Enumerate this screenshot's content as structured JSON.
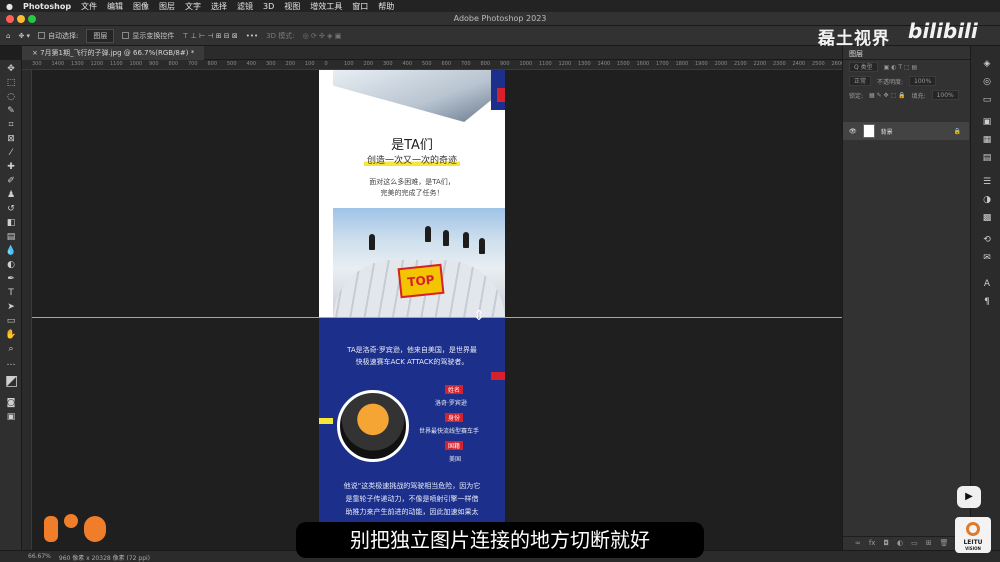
{
  "menubar": {
    "apple_icon": "apple-icon",
    "app_name": "Photoshop",
    "items": [
      "文件",
      "编辑",
      "图像",
      "图层",
      "文字",
      "选择",
      "滤镜",
      "3D",
      "视图",
      "增效工具",
      "窗口",
      "帮助"
    ]
  },
  "window": {
    "title": "Adobe Photoshop 2023"
  },
  "options": {
    "auto_select_label": "自动选择:",
    "auto_select_value": "图层",
    "show_transform_label": "显示变换控件",
    "mode_3d_label": "3D 模式:"
  },
  "document": {
    "tab_label": "7月第1期_飞行的子弹.jpg @ 66.7%(RGB/8#) *"
  },
  "ruler": {
    "ticks": [
      "300",
      "1400",
      "1300",
      "1200",
      "1100",
      "1000",
      "900",
      "800",
      "700",
      "600",
      "500",
      "400",
      "300",
      "200",
      "100",
      "0",
      "100",
      "200",
      "300",
      "400",
      "500",
      "600",
      "700",
      "800",
      "900",
      "1000",
      "1100",
      "1200",
      "1300",
      "1400",
      "1500",
      "1600",
      "1700",
      "1800",
      "1900",
      "2000",
      "2100",
      "2200",
      "2300",
      "2400",
      "2500",
      "2600"
    ]
  },
  "artwork": {
    "heading": "是TA们",
    "tagline": "创造一次又一次的奇迹",
    "intro_line1": "面对这么多困难，是TA们，",
    "intro_line2": "完美的完成了任务！",
    "logo_text": "TOP",
    "bio_line1": "TA是洛奇·罗宾逊，他来自美国，是世界最",
    "bio_line2": "快极速赛车ACK ATTACK的驾驶者。",
    "name_label": "姓名",
    "name_value": "洛奇·罗宾逊",
    "identity_label": "身份",
    "identity_value": "世界最快流线型赛车手",
    "nation_label": "国籍",
    "nation_value": "美国",
    "story_line1": "他说“这类极速挑战的驾驶相当危险，因为它",
    "story_line2": "是靠轮子传递动力，不像是喷射引擎一样借",
    "story_line3": "助推力来产生前进的动能，因此加速如果太"
  },
  "layers_panel": {
    "tab_label": "图层",
    "filter_label": "Q 类型",
    "blend_mode": "正常",
    "opacity_label": "不透明度:",
    "opacity_value": "100%",
    "lock_label": "锁定:",
    "fill_label": "填充:",
    "fill_value": "100%",
    "layer_name": "背景"
  },
  "status": {
    "zoom": "66.67%",
    "doc_size": "960 像素 x 20328 像素 (72 ppi)"
  },
  "overlay": {
    "watermark": "磊土视界",
    "bilibili": "bilibili",
    "subtitle": "别把独立图片连接的地方切断就好",
    "leitu_line1": "LEITU",
    "leitu_line2": "VISION"
  },
  "colors": {
    "accent_blue": "#1c2f8a",
    "accent_red": "#d6202b",
    "highlight_yellow": "#f7e63a",
    "guide_cyan": "#51c5e8",
    "brand_orange": "#f07d2a"
  }
}
